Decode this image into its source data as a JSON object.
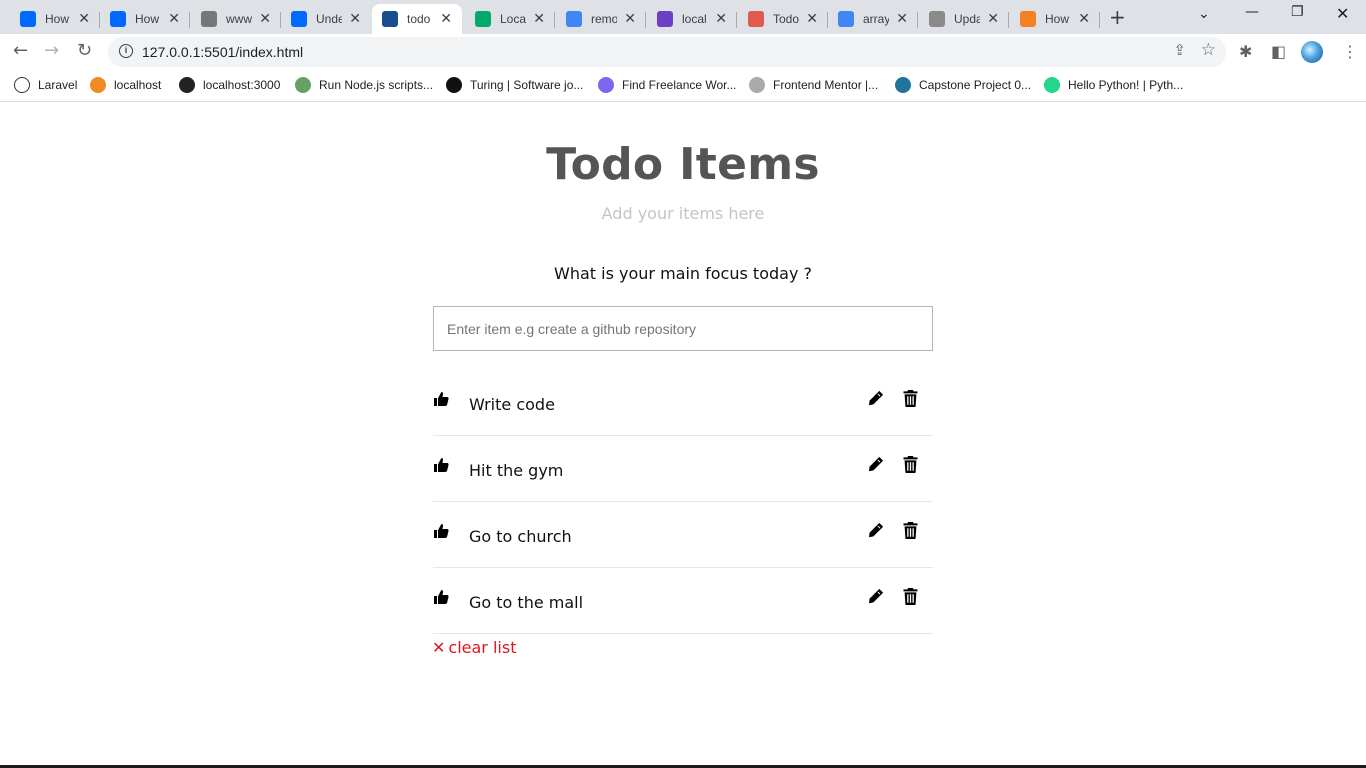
{
  "browser": {
    "tabs": [
      {
        "title": "How",
        "favicon": "digitalocean-icon",
        "color": "#0069ff"
      },
      {
        "title": "How",
        "favicon": "digitalocean-icon",
        "color": "#0069ff"
      },
      {
        "title": "www",
        "favicon": "github-icon",
        "color": "#777777"
      },
      {
        "title": "Unde",
        "favicon": "digitalocean-icon",
        "color": "#0069ff"
      },
      {
        "title": "todo",
        "favicon": "todo-app-icon",
        "color": "#1a4d8f",
        "active": true
      },
      {
        "title": "Loca",
        "favicon": "w3-icon",
        "color": "#04aa6d"
      },
      {
        "title": "remo",
        "favicon": "google-icon",
        "color": "#4285f4"
      },
      {
        "title": "local",
        "favicon": "rocket-icon",
        "color": "#6c3fc5"
      },
      {
        "title": "Todo",
        "favicon": "trello-icon",
        "color": "#e05a4f"
      },
      {
        "title": "array",
        "favicon": "google-icon",
        "color": "#4285f4"
      },
      {
        "title": "Upda",
        "favicon": "ext-icon",
        "color": "#8a8a8a"
      },
      {
        "title": "How",
        "favicon": "stackoverflow-icon",
        "color": "#f48024"
      }
    ],
    "url": "127.0.0.1:5501/index.html",
    "bookmarks": [
      {
        "label": "Laravel",
        "icon": "laravel-icon",
        "color": "#ffffff"
      },
      {
        "label": "localhost",
        "icon": "xampp-icon",
        "color": "#f08a24"
      },
      {
        "label": "localhost:3000",
        "icon": "react-icon",
        "color": "#222222"
      },
      {
        "label": "Run Node.js scripts...",
        "icon": "nodejs-icon",
        "color": "#68a063"
      },
      {
        "label": "Turing | Software jo...",
        "icon": "turing-icon",
        "color": "#111111"
      },
      {
        "label": "Find Freelance Wor...",
        "icon": "freelance-icon",
        "color": "#7b68ee"
      },
      {
        "label": "Frontend Mentor |...",
        "icon": "frontend-mentor-icon",
        "color": "#aaaaaa"
      },
      {
        "label": "Capstone Project 0...",
        "icon": "wordpress-icon",
        "color": "#21759b"
      },
      {
        "label": "Hello Python! | Pyth...",
        "icon": "pycharm-icon",
        "color": "#21d789"
      }
    ]
  },
  "app": {
    "title": "Todo Items",
    "subtitle": "Add your items here",
    "question": "What is your main focus today ?",
    "input_placeholder": "Enter item e.g create a github repository",
    "items": [
      {
        "text": "Write code"
      },
      {
        "text": "Hit the gym"
      },
      {
        "text": "Go to church"
      },
      {
        "text": "Go to the mall"
      }
    ],
    "clear_label": "clear list",
    "accent_color": "#e0161e"
  }
}
